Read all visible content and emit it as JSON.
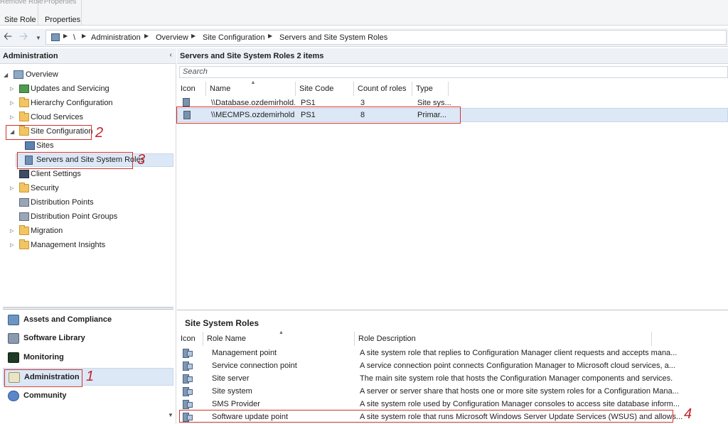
{
  "ribbon": {
    "group1_top": "Remove Role",
    "group1_caption": "Site Role",
    "group2_top": "Properties",
    "group2_caption": "Properties"
  },
  "breadcrumb": [
    "\\",
    "Administration",
    "Overview",
    "Site Configuration",
    "Servers and Site System Roles"
  ],
  "left": {
    "title": "Administration",
    "tree": {
      "overview": "Overview",
      "updates": "Updates and Servicing",
      "hierarchy": "Hierarchy Configuration",
      "cloud": "Cloud Services",
      "site_config": "Site Configuration",
      "sites": "Sites",
      "servers": "Servers and Site System Roles",
      "client": "Client Settings",
      "security": "Security",
      "dp": "Distribution Points",
      "dpg": "Distribution Point Groups",
      "migration": "Migration",
      "insights": "Management Insights"
    },
    "workspaces": {
      "assets": "Assets and Compliance",
      "software": "Software Library",
      "monitoring": "Monitoring",
      "administration": "Administration",
      "community": "Community"
    }
  },
  "top": {
    "title": "Servers and Site System Roles 2 items",
    "search_placeholder": "Search",
    "columns": {
      "icon": "Icon",
      "name": "Name",
      "site_code": "Site Code",
      "count": "Count of roles",
      "type": "Type"
    },
    "rows": [
      {
        "name": "\\\\Database.ozdemirhold...",
        "site_code": "PS1",
        "count": "3",
        "type": "Site sys..."
      },
      {
        "name": "\\\\MECMPS.ozdemirhold...",
        "site_code": "PS1",
        "count": "8",
        "type": "Primar..."
      }
    ]
  },
  "bottom": {
    "title": "Site System Roles",
    "columns": {
      "icon": "Icon",
      "role": "Role Name",
      "desc": "Role Description"
    },
    "rows": [
      {
        "role": "Management point",
        "desc": "A site system role that replies to Configuration Manager client requests and accepts mana..."
      },
      {
        "role": "Service connection point",
        "desc": "A service connection point connects Configuration Manager to Microsoft cloud services, a..."
      },
      {
        "role": "Site server",
        "desc": "The main site system role that hosts the Configuration Manager components and services."
      },
      {
        "role": "Site system",
        "desc": "A server or server share that hosts one or more site system roles for a Configuration Mana..."
      },
      {
        "role": "SMS Provider",
        "desc": "A site system role used by Configuration Manager consoles to access site database inform..."
      },
      {
        "role": "Software update point",
        "desc": "A site system role that runs Microsoft Windows Server Update Services (WSUS) and allows..."
      }
    ]
  },
  "annotations": {
    "a1": "1",
    "a2": "2",
    "a3": "3",
    "a4": "4"
  },
  "colors": {
    "accent_red": "#d0342c",
    "selection": "#dde8f6"
  }
}
